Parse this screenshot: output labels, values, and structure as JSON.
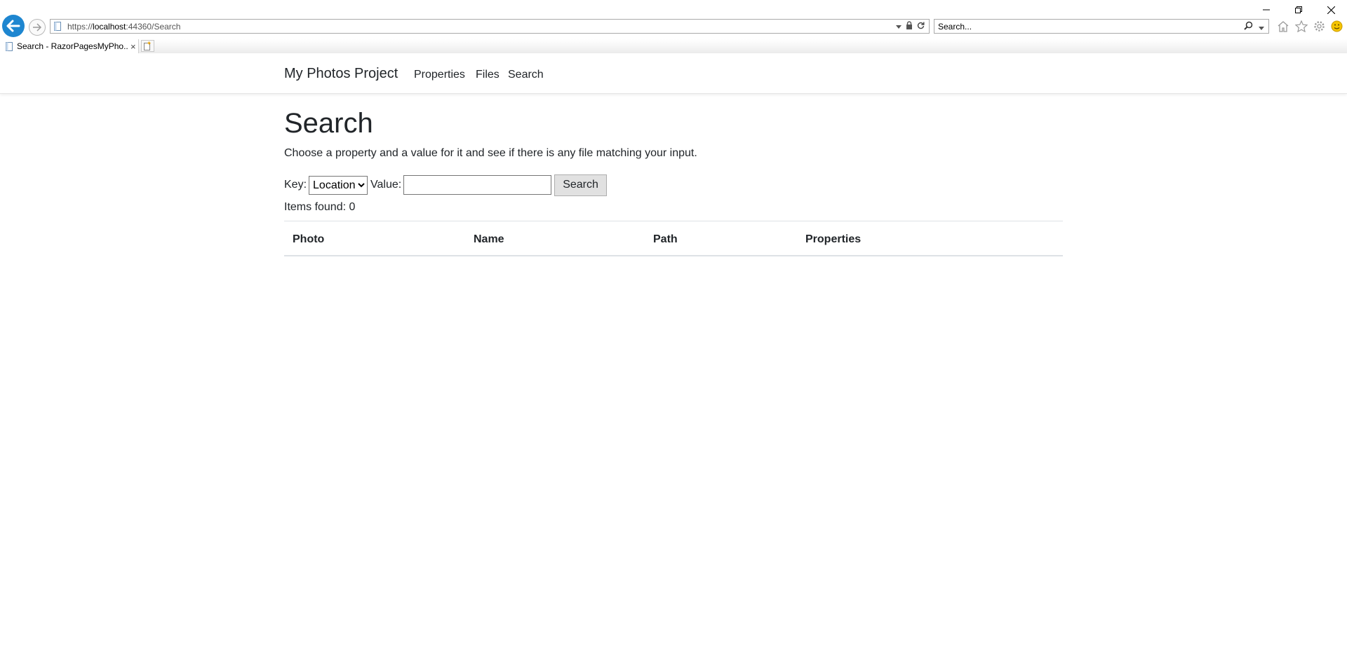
{
  "browser": {
    "url_scheme": "https://",
    "url_host": "localhost",
    "url_rest": ":44360/Search",
    "search_placeholder": "Search...",
    "tab_title": "Search - RazorPagesMyPho...",
    "tab_close": "×"
  },
  "navbar": {
    "brand": "My Photos Project",
    "links": [
      "Properties",
      "Files",
      "Search"
    ]
  },
  "main": {
    "title": "Search",
    "description": "Choose a property and a value for it and see if there is any file matching your input.",
    "key_label": "Key:",
    "key_selected": "Location",
    "value_label": "Value:",
    "value_input": "",
    "search_button": "Search",
    "items_found": "Items found: 0",
    "table_headers": [
      "Photo",
      "Name",
      "Path",
      "Properties"
    ]
  },
  "colors": {
    "back_button": "#1e86d0",
    "text": "#212529",
    "divider": "#dee2e6"
  }
}
